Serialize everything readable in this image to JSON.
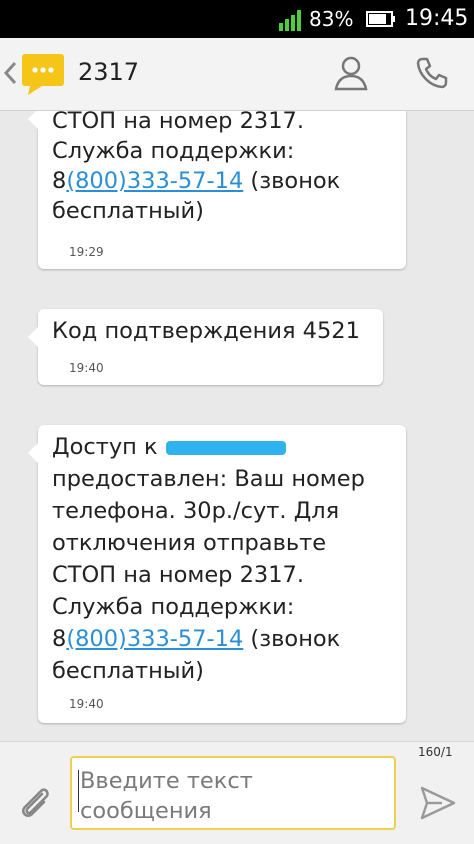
{
  "status_bar": {
    "battery_percent": "83%",
    "time": "19:45"
  },
  "action_bar": {
    "thread_title": "2317"
  },
  "messages": [
    {
      "lines": [
        {
          "text": "СТОП на номер 2317."
        },
        {
          "text": "Служба поддержки:"
        },
        {
          "prefix": "8",
          "link": "(800)333-57-14",
          "suffix": " (звонок"
        },
        {
          "text": "бесплатный)"
        }
      ],
      "time": "19:29"
    },
    {
      "lines": [
        {
          "text": "Код подтверждения 4521"
        }
      ],
      "time": "19:40"
    },
    {
      "lines": [
        {
          "text": "Доступ к"
        },
        {
          "text": "предоставлен: Ваш номер"
        },
        {
          "text": "телефона. 30р./сут. Для"
        },
        {
          "text": "отключения отправьте"
        },
        {
          "text": "СТОП на номер 2317."
        },
        {
          "text": "Служба поддержки:"
        },
        {
          "prefix": "8",
          "link": "(800)333-57-14",
          "suffix": " (звонок"
        },
        {
          "text": "бесплатный)"
        }
      ],
      "time": "19:40"
    }
  ],
  "composer": {
    "counter": "160/1",
    "placeholder": "Введите текст\nсообщения"
  },
  "colors": {
    "accent": "#f0d24a",
    "link": "#2a8fd6",
    "signal": "#4ccf3a"
  }
}
